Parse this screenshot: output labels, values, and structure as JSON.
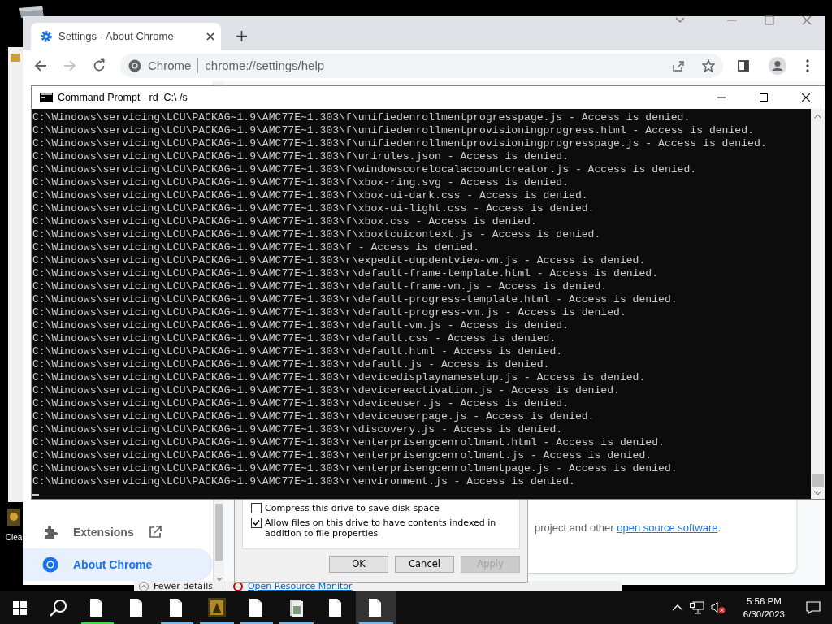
{
  "desktop": {
    "icons": [
      {
        "label": "Clea"
      }
    ]
  },
  "chrome": {
    "tabs": [
      {
        "title": "Settings - About Chrome",
        "selected": true
      }
    ],
    "omnibox": {
      "chip": "Chrome",
      "url": "chrome://settings/help"
    },
    "sidebar": [
      {
        "label": "Extensions",
        "kind": "extensions",
        "selected": false
      },
      {
        "label": "About Chrome",
        "kind": "about",
        "selected": true
      }
    ],
    "content": {
      "text_before": "project and other ",
      "link": "open source software",
      "text_after": "."
    }
  },
  "drive_dialog": {
    "options": [
      {
        "label": "Compress this drive to save disk space",
        "checked": false
      },
      {
        "label": "Allow files on this drive to have contents indexed in addition to file properties",
        "checked": true
      }
    ],
    "buttons": [
      {
        "label": "OK",
        "disabled": false
      },
      {
        "label": "Cancel",
        "disabled": false
      },
      {
        "label": "Apply",
        "disabled": true
      }
    ]
  },
  "task_manager": {
    "fewer_details": "Fewer details",
    "resource_monitor": "Open Resource Monitor"
  },
  "cmd": {
    "title": "Command Prompt - rd  C:\\ /s",
    "lines": [
      "C:\\Windows\\servicing\\LCU\\PACKAG~1.9\\AMC77E~1.303\\f\\unifiedenrollmentprogresspage.js - Access is denied.",
      "C:\\Windows\\servicing\\LCU\\PACKAG~1.9\\AMC77E~1.303\\f\\unifiedenrollmentprovisioningprogress.html - Access is denied.",
      "C:\\Windows\\servicing\\LCU\\PACKAG~1.9\\AMC77E~1.303\\f\\unifiedenrollmentprovisioningprogresspage.js - Access is denied.",
      "C:\\Windows\\servicing\\LCU\\PACKAG~1.9\\AMC77E~1.303\\f\\urirules.json - Access is denied.",
      "C:\\Windows\\servicing\\LCU\\PACKAG~1.9\\AMC77E~1.303\\f\\windowscorelocalaccountcreator.js - Access is denied.",
      "C:\\Windows\\servicing\\LCU\\PACKAG~1.9\\AMC77E~1.303\\f\\xbox-ring.svg - Access is denied.",
      "C:\\Windows\\servicing\\LCU\\PACKAG~1.9\\AMC77E~1.303\\f\\xbox-ui-dark.css - Access is denied.",
      "C:\\Windows\\servicing\\LCU\\PACKAG~1.9\\AMC77E~1.303\\f\\xbox-ui-light.css - Access is denied.",
      "C:\\Windows\\servicing\\LCU\\PACKAG~1.9\\AMC77E~1.303\\f\\xbox.css - Access is denied.",
      "C:\\Windows\\servicing\\LCU\\PACKAG~1.9\\AMC77E~1.303\\f\\xboxtcuicontext.js - Access is denied.",
      "C:\\Windows\\servicing\\LCU\\PACKAG~1.9\\AMC77E~1.303\\f - Access is denied.",
      "C:\\Windows\\servicing\\LCU\\PACKAG~1.9\\AMC77E~1.303\\r\\expedit-dupdentview-vm.js - Access is denied.",
      "C:\\Windows\\servicing\\LCU\\PACKAG~1.9\\AMC77E~1.303\\r\\default-frame-template.html - Access is denied.",
      "C:\\Windows\\servicing\\LCU\\PACKAG~1.9\\AMC77E~1.303\\r\\default-frame-vm.js - Access is denied.",
      "C:\\Windows\\servicing\\LCU\\PACKAG~1.9\\AMC77E~1.303\\r\\default-progress-template.html - Access is denied.",
      "C:\\Windows\\servicing\\LCU\\PACKAG~1.9\\AMC77E~1.303\\r\\default-progress-vm.js - Access is denied.",
      "C:\\Windows\\servicing\\LCU\\PACKAG~1.9\\AMC77E~1.303\\r\\default-vm.js - Access is denied.",
      "C:\\Windows\\servicing\\LCU\\PACKAG~1.9\\AMC77E~1.303\\r\\default.css - Access is denied.",
      "C:\\Windows\\servicing\\LCU\\PACKAG~1.9\\AMC77E~1.303\\r\\default.html - Access is denied.",
      "C:\\Windows\\servicing\\LCU\\PACKAG~1.9\\AMC77E~1.303\\r\\default.js - Access is denied.",
      "C:\\Windows\\servicing\\LCU\\PACKAG~1.9\\AMC77E~1.303\\r\\devicedisplaynamesetup.js - Access is denied.",
      "C:\\Windows\\servicing\\LCU\\PACKAG~1.9\\AMC77E~1.303\\r\\devicereactivation.js - Access is denied.",
      "C:\\Windows\\servicing\\LCU\\PACKAG~1.9\\AMC77E~1.303\\r\\deviceuser.js - Access is denied.",
      "C:\\Windows\\servicing\\LCU\\PACKAG~1.9\\AMC77E~1.303\\r\\deviceuserpage.js - Access is denied.",
      "C:\\Windows\\servicing\\LCU\\PACKAG~1.9\\AMC77E~1.303\\r\\discovery.js - Access is denied.",
      "C:\\Windows\\servicing\\LCU\\PACKAG~1.9\\AMC77E~1.303\\r\\enterprisengcenrollment.html - Access is denied.",
      "C:\\Windows\\servicing\\LCU\\PACKAG~1.9\\AMC77E~1.303\\r\\enterprisengcenrollment.js - Access is denied.",
      "C:\\Windows\\servicing\\LCU\\PACKAG~1.9\\AMC77E~1.303\\r\\enterprisengcenrollmentpage.js - Access is denied.",
      "C:\\Windows\\servicing\\LCU\\PACKAG~1.9\\AMC77E~1.303\\r\\environment.js - Access is denied."
    ]
  },
  "taskbar": {
    "apps": [
      {
        "kind": "document",
        "color": "#3ddc4a",
        "selected": false
      },
      {
        "kind": "document",
        "selected": false
      },
      {
        "kind": "document",
        "color": "#76b9ed",
        "selected": false
      },
      {
        "kind": "app",
        "color": "#76b9ed",
        "selected": false
      },
      {
        "kind": "document",
        "color": "#76b9ed",
        "selected": false
      },
      {
        "kind": "stack",
        "color": "#76b9ed",
        "selected": false
      },
      {
        "kind": "document",
        "selected": false
      },
      {
        "kind": "document",
        "color": "#76b9ed",
        "selected": true
      }
    ],
    "time": "5:56 PM",
    "date": "6/30/2023"
  }
}
